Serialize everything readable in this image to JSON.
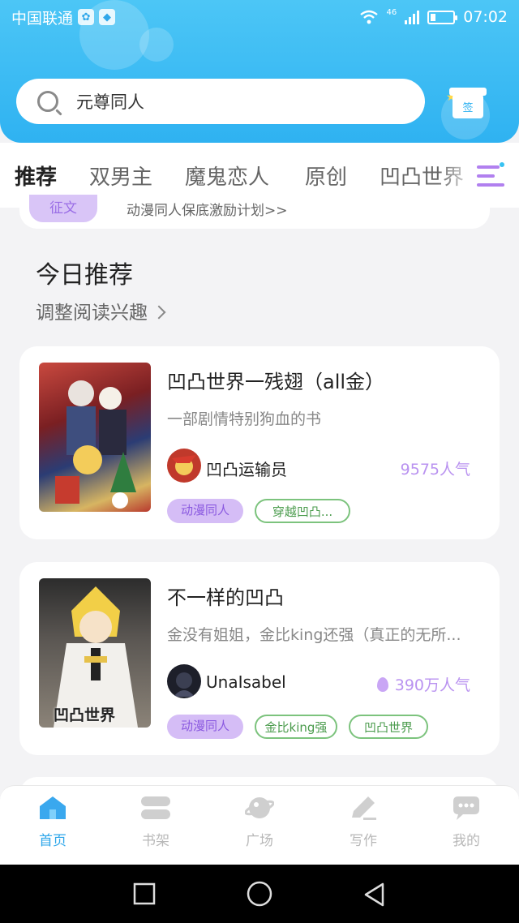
{
  "status_bar": {
    "carrier": "中国联通",
    "network": "46",
    "time": "07:02"
  },
  "search": {
    "placeholder": "元尊同人"
  },
  "checkin": {
    "label": "签"
  },
  "tabs": [
    {
      "label": "推荐",
      "active": true
    },
    {
      "label": "双男主",
      "active": false
    },
    {
      "label": "魔鬼恋人",
      "active": false
    },
    {
      "label": "原创",
      "active": false
    },
    {
      "label": "凹凸世界",
      "active": false
    }
  ],
  "banner": {
    "badge": "征文",
    "text": "动漫同人保底激励计划>>"
  },
  "section": {
    "title": "今日推荐",
    "subtitle": "调整阅读兴趣"
  },
  "books": [
    {
      "title": "凹凸世界一残翅（all金）",
      "description": "一部剧情特别狗血的书",
      "author": "凹凸运输员",
      "popularity": "9575人气",
      "tags": [
        "动漫同人",
        "穿越凹凸..."
      ]
    },
    {
      "title": "不一样的凹凸",
      "description": "金没有姐姐，金比king还强（真正的无所...",
      "author": "UnaIsabel",
      "popularity": "390万人气",
      "cover_text": "凹凸世界",
      "tags": [
        "动漫同人",
        "金比king强",
        "凹凸世界"
      ]
    }
  ],
  "bottom_nav": [
    {
      "label": "首页",
      "icon": "home-icon",
      "active": true
    },
    {
      "label": "书架",
      "icon": "bookshelf-icon",
      "active": false
    },
    {
      "label": "广场",
      "icon": "planet-icon",
      "active": false
    },
    {
      "label": "写作",
      "icon": "pen-icon",
      "active": false
    },
    {
      "label": "我的",
      "icon": "chat-bubble-icon",
      "active": false
    }
  ],
  "colors": {
    "header": "#2fb2f1",
    "accent_purple": "#b992f0",
    "tag_green": "#7cc37d",
    "active_nav": "#2fa7ea"
  }
}
